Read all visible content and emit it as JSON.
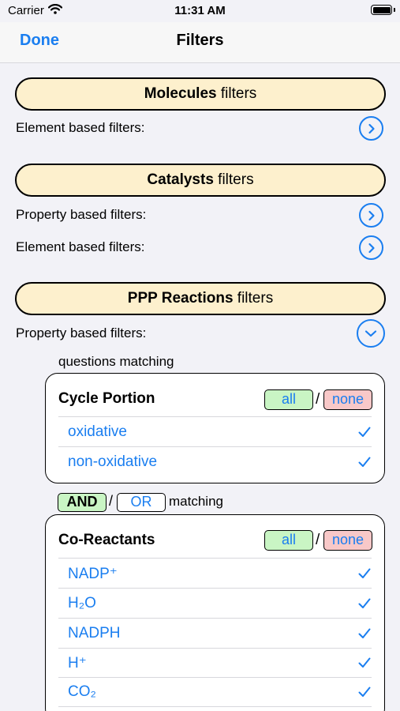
{
  "status_bar": {
    "carrier": "Carrier",
    "time": "11:31 AM"
  },
  "nav": {
    "done_label": "Done",
    "title": "Filters"
  },
  "sections": {
    "molecules": {
      "name": "Molecules",
      "suffix": " filters",
      "rows": [
        "Element based filters:"
      ]
    },
    "catalysts": {
      "name": "Catalysts",
      "suffix": " filters",
      "rows": [
        "Property based filters:",
        "Element based filters:"
      ]
    },
    "ppp": {
      "name": "PPP Reactions",
      "suffix": " filters",
      "rows": [
        "Property based filters:"
      ]
    }
  },
  "questions_matching_label": "questions matching",
  "cycle_portion": {
    "title": "Cycle Portion",
    "all_label": "all",
    "slash": "/",
    "none_label": "none",
    "items": [
      {
        "label": "oxidative",
        "checked": true
      },
      {
        "label": "non-oxidative",
        "checked": true
      }
    ]
  },
  "logic": {
    "and_label": "AND",
    "slash": "/",
    "or_label": "OR",
    "matching_label": "matching",
    "selected": "AND"
  },
  "co_reactants": {
    "title": "Co-Reactants",
    "all_label": "all",
    "slash": "/",
    "none_label": "none",
    "items": [
      {
        "label": "NADP⁺",
        "checked": true
      },
      {
        "label": "H₂O",
        "checked": true
      },
      {
        "label": "NADPH",
        "checked": true
      },
      {
        "label": "H⁺",
        "checked": true
      },
      {
        "label": "CO₂",
        "checked": true
      }
    ]
  },
  "colors": {
    "accent": "#1a7ef0",
    "section_fill": "#fdf0cd",
    "all_fill": "#c9f5c4",
    "none_fill": "#f8c8c8",
    "background": "#f2f2f7"
  },
  "icons": {
    "expand": "chevron-right-circle-icon",
    "collapse": "chevron-down-circle-icon",
    "check": "checkmark-icon",
    "wifi": "wifi-icon",
    "battery": "battery-icon"
  }
}
